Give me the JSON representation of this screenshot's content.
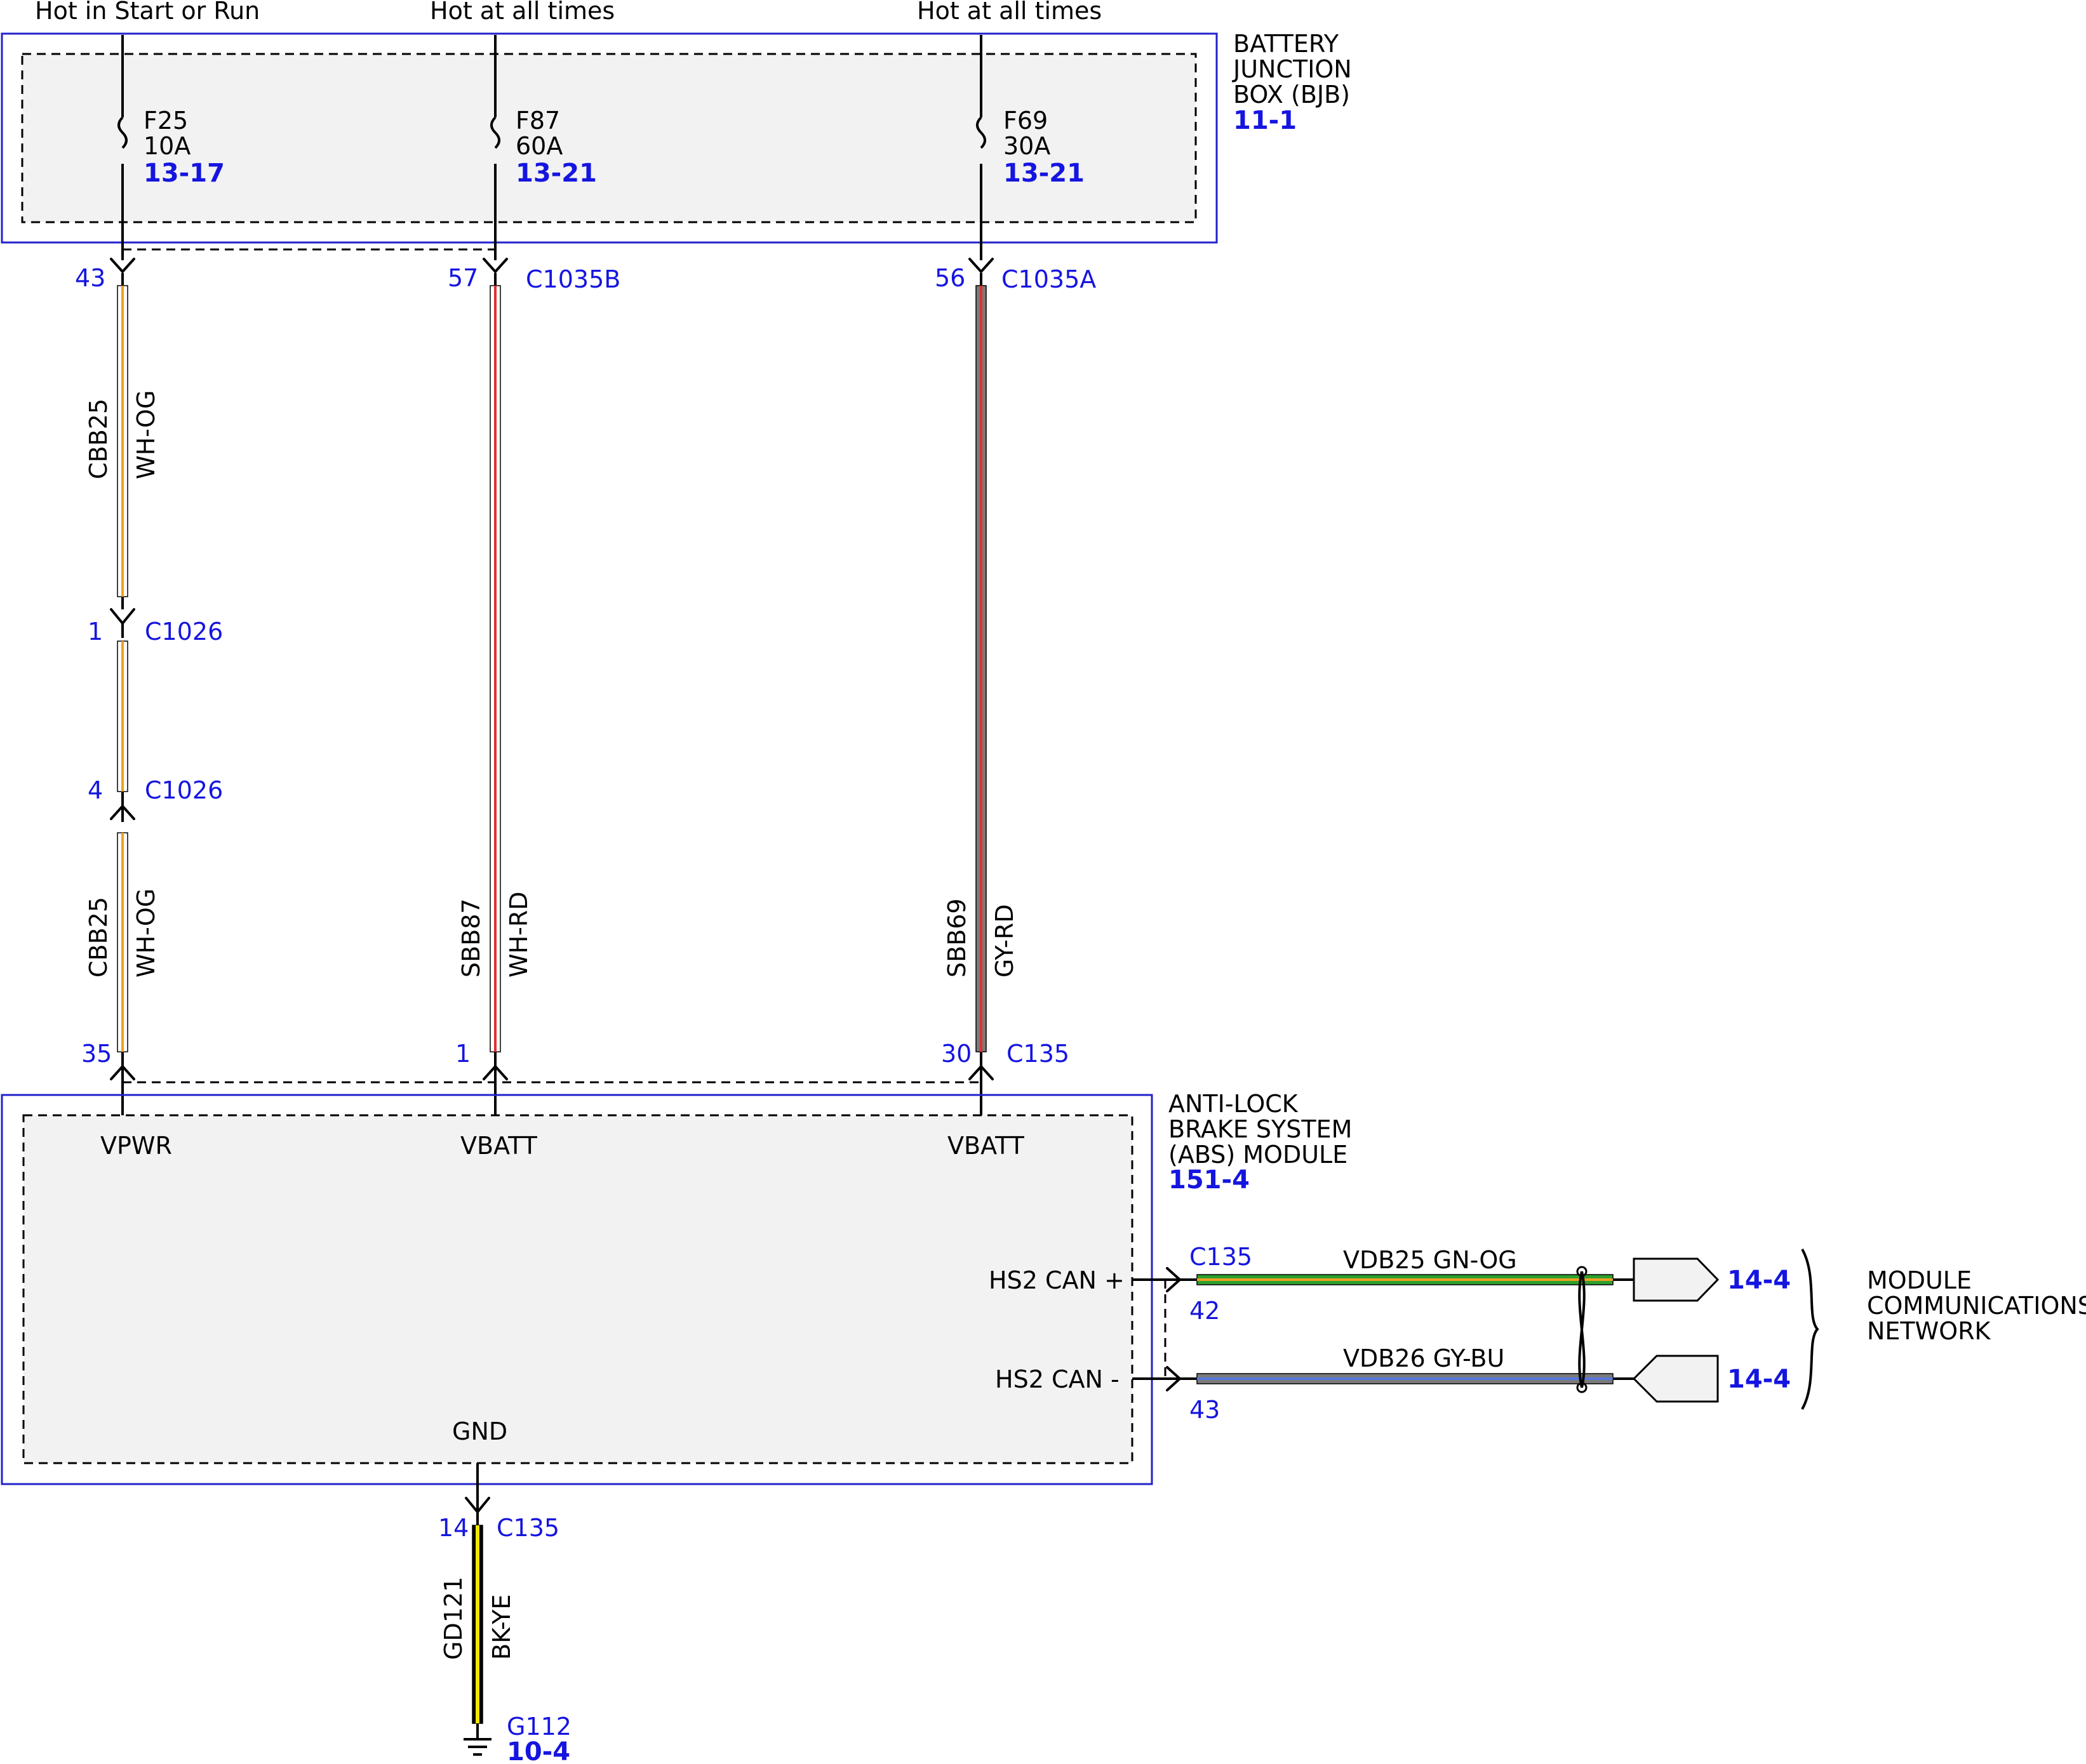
{
  "colors": {
    "wire_WH": "#ffffff",
    "wire_OG": "#f0a020",
    "wire_RD": "#e03030",
    "wire_GY": "#7a7a7a",
    "wire_GN": "#2ea02e",
    "wire_BU": "#5577dd",
    "wire_BK": "#000000",
    "wire_YE": "#f2e600",
    "reference_blue": "#1515e0",
    "box_border": "#2222cc"
  },
  "feeds": {
    "f25_feed": "Hot in Start or Run",
    "f87_feed": "Hot at all times",
    "f69_feed": "Hot at all times"
  },
  "bjb": {
    "label_line1": "BATTERY",
    "label_line2": "JUNCTION",
    "label_line3": "BOX (BJB)",
    "ref": "11-1",
    "fuses": [
      {
        "id": "F25",
        "rating": "10A",
        "ref": "13-17"
      },
      {
        "id": "F87",
        "rating": "60A",
        "ref": "13-21"
      },
      {
        "id": "F69",
        "rating": "30A",
        "ref": "13-21"
      }
    ]
  },
  "connectors": {
    "c1035b_pin43": "43",
    "c1035b_pin57": "57",
    "c1035b_label": "C1035B",
    "c1035a_pin56": "56",
    "c1035a_label": "C1035A",
    "c1026_pin1": "1",
    "c1026_pin1_label": "C1026",
    "c1026_pin4": "4",
    "c1026_pin4_label": "C1026",
    "c135_pin35": "35",
    "c135_pin1": "1",
    "c135_pin30": "30",
    "c135_label": "C135",
    "c135_pin42": "42",
    "c135_pin43": "43",
    "c135_can_label": "C135",
    "c135_pin14": "14",
    "c135_gnd_label": "C135"
  },
  "wires": {
    "cbb25_upper_circuit": "CBB25",
    "cbb25_upper_color": "WH-OG",
    "cbb25_lower_circuit": "CBB25",
    "cbb25_lower_color": "WH-OG",
    "sbb87_circuit": "SBB87",
    "sbb87_color": "WH-RD",
    "sbb69_circuit": "SBB69",
    "sbb69_color": "GY-RD",
    "vdb25_label": "VDB25  GN-OG",
    "vdb26_label": "VDB26  GY-BU",
    "gd121_circuit": "GD121",
    "gd121_color": "BK-YE"
  },
  "abs": {
    "label_line1": "ANTI-LOCK",
    "label_line2": "BRAKE SYSTEM",
    "label_line3": "(ABS) MODULE",
    "ref": "151-4",
    "pins": {
      "vpwr": "VPWR",
      "vbatt1": "VBATT",
      "vbatt2": "VBATT",
      "can_plus": "HS2 CAN +",
      "can_minus": "HS2 CAN -",
      "gnd": "GND"
    }
  },
  "network": {
    "ref_plus": "14-4",
    "ref_minus": "14-4",
    "label_line1": "MODULE",
    "label_line2": "COMMUNICATIONS",
    "label_line3": "NETWORK"
  },
  "ground": {
    "id": "G112",
    "ref": "10-4"
  }
}
